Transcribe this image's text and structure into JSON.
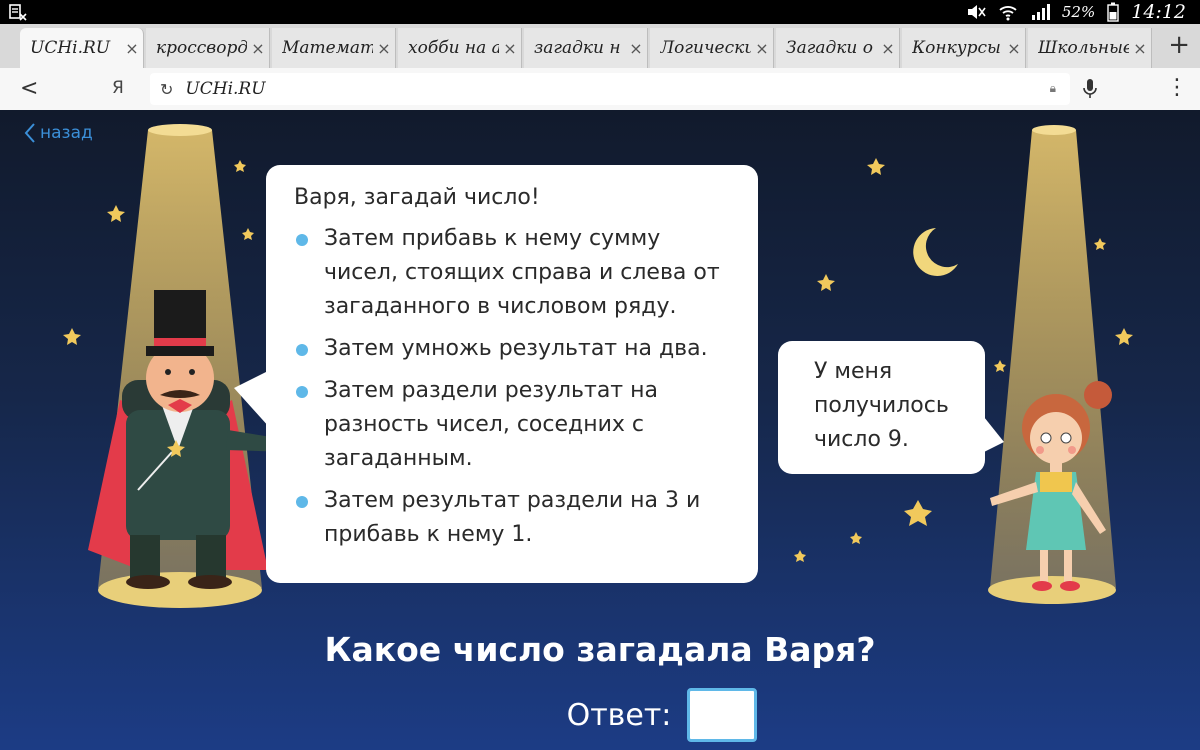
{
  "statusbar": {
    "battery": "52%",
    "time": "14:12"
  },
  "tabs": [
    {
      "label": "UCHi.RU",
      "active": true
    },
    {
      "label": "кроссворд"
    },
    {
      "label": "Математи"
    },
    {
      "label": "хобби на а"
    },
    {
      "label": "загадки н"
    },
    {
      "label": "Логически"
    },
    {
      "label": "Загадки о"
    },
    {
      "label": "Конкурсы"
    },
    {
      "label": "Школьные"
    }
  ],
  "close_glyph": "×",
  "newtab_glyph": "+",
  "addressbar": {
    "back_glyph": "<",
    "ya_label": "Я",
    "url": "UCHi.RU"
  },
  "page": {
    "back_link": "назад",
    "magician_bubble": {
      "lead": "Варя, загадай число!",
      "steps": [
        "Затем прибавь к нему сумму чисел, стоящих справа и слева от загаданного в числовом ряду.",
        "Затем умножь результат на два.",
        "Затем раздели результат на разность чисел, соседних с загаданным.",
        "Затем результат раздели на 3 и прибавь к нему 1."
      ]
    },
    "girl_bubble": "У меня получилось число 9.",
    "question": "Какое число загадала Варя?",
    "answer_label": "Ответ:",
    "answer_value": ""
  },
  "colors": {
    "accent": "#5fb8e8",
    "link": "#3b8fd8",
    "sky_top": "#111a2c",
    "sky_bottom": "#1c3c85"
  }
}
